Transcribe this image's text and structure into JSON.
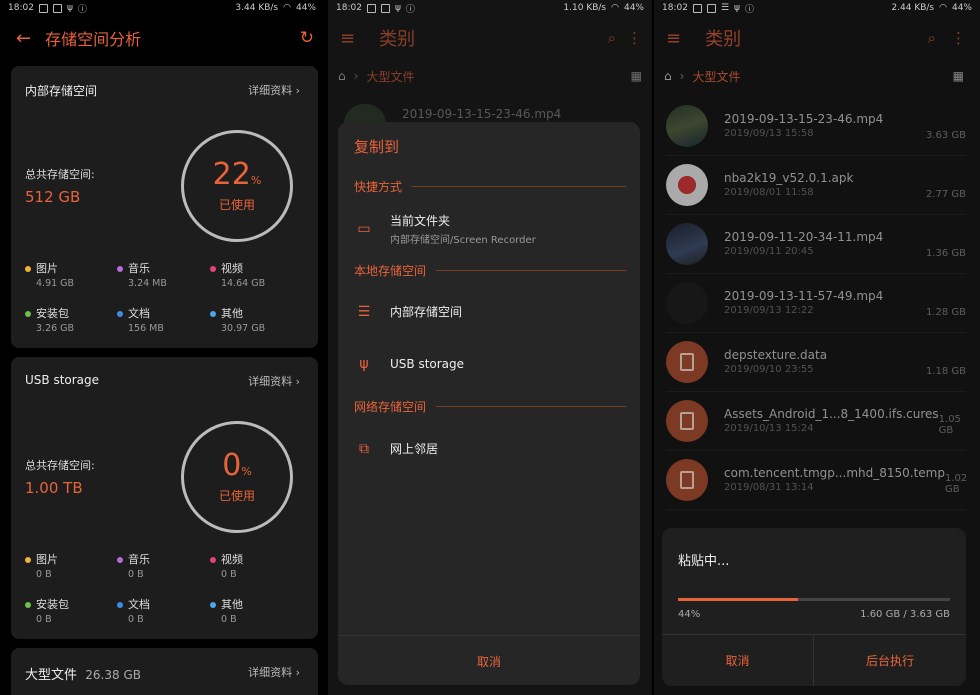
{
  "panel1": {
    "status": {
      "time": "18:02",
      "speed": "3.44 KB/s",
      "battery": "44%"
    },
    "title": "存储空间分析",
    "internal": {
      "title": "内部存储空间",
      "detail": "详细资料",
      "total_label": "总共存储空间:",
      "total_value": "512 GB",
      "percent": "22",
      "percent_sign": "%",
      "used_label": "已使用",
      "categories": [
        {
          "name": "图片",
          "size": "4.91 GB",
          "color": "#f0b432"
        },
        {
          "name": "音乐",
          "size": "3.24 MB",
          "color": "#b86ad8"
        },
        {
          "name": "视频",
          "size": "14.64 GB",
          "color": "#e8427a"
        },
        {
          "name": "安装包",
          "size": "3.26 GB",
          "color": "#6cc24a"
        },
        {
          "name": "文档",
          "size": "156 MB",
          "color": "#3a8ee8"
        },
        {
          "name": "其他",
          "size": "30.97 GB",
          "color": "#4aa8e8"
        }
      ]
    },
    "usb": {
      "title": "USB storage",
      "detail": "详细资料",
      "total_label": "总共存储空间:",
      "total_value": "1.00 TB",
      "percent": "0",
      "percent_sign": "%",
      "used_label": "已使用",
      "categories": [
        {
          "name": "图片",
          "size": "0 B",
          "color": "#f0b432"
        },
        {
          "name": "音乐",
          "size": "0 B",
          "color": "#b86ad8"
        },
        {
          "name": "视频",
          "size": "0 B",
          "color": "#e8427a"
        },
        {
          "name": "安装包",
          "size": "0 B",
          "color": "#6cc24a"
        },
        {
          "name": "文档",
          "size": "0 B",
          "color": "#3a8ee8"
        },
        {
          "name": "其他",
          "size": "0 B",
          "color": "#4aa8e8"
        }
      ]
    },
    "large": {
      "title": "大型文件",
      "size": "26.38 GB",
      "detail": "详细资料"
    }
  },
  "panel2": {
    "status": {
      "time": "18:02",
      "speed": "1.10 KB/s",
      "battery": "44%"
    },
    "title": "类别",
    "breadcrumb": "大型文件",
    "bg_file": "2019-09-13-15-23-46.mp4",
    "dialog": {
      "title": "复制到",
      "shortcut_section": "快捷方式",
      "current_folder": "当前文件夹",
      "current_folder_path": "内部存储空间/Screen Recorder",
      "local_section": "本地存储空间",
      "internal": "内部存储空间",
      "usb": "USB storage",
      "network_section": "网络存储空间",
      "network": "网上邻居",
      "cancel": "取消"
    }
  },
  "panel3": {
    "status": {
      "time": "18:02",
      "speed": "2.44 KB/s",
      "battery": "44%"
    },
    "title": "类别",
    "breadcrumb": "大型文件",
    "files": [
      {
        "name": "2019-09-13-15-23-46.mp4",
        "date": "2019/09/13 15:58",
        "size": "3.63 GB",
        "kind": "video"
      },
      {
        "name": "nba2k19_v52.0.1.apk",
        "date": "2019/08/01 11:58",
        "size": "2.77 GB",
        "kind": "apk"
      },
      {
        "name": "2019-09-11-20-34-11.mp4",
        "date": "2019/09/11 20:45",
        "size": "1.36 GB",
        "kind": "video2"
      },
      {
        "name": "2019-09-13-11-57-49.mp4",
        "date": "2019/09/13 12:22",
        "size": "1.28 GB",
        "kind": "dark"
      },
      {
        "name": "depstexture.data",
        "date": "2019/09/10 23:55",
        "size": "1.18 GB",
        "kind": "doc"
      },
      {
        "name": "Assets_Android_1...8_1400.ifs.cures",
        "date": "2019/10/13 15:24",
        "size": "1.05 GB",
        "kind": "doc"
      },
      {
        "name": "com.tencent.tmgp...mhd_8150.temp",
        "date": "2019/08/31 13:14",
        "size": "1.02 GB",
        "kind": "doc"
      }
    ],
    "progress": {
      "title": "粘贴中...",
      "percent_text": "44%",
      "fraction": 0.44,
      "detail": "1.60 GB / 3.63 GB",
      "cancel": "取消",
      "background": "后台执行"
    }
  },
  "colors": {
    "accent": "#e8633a"
  }
}
